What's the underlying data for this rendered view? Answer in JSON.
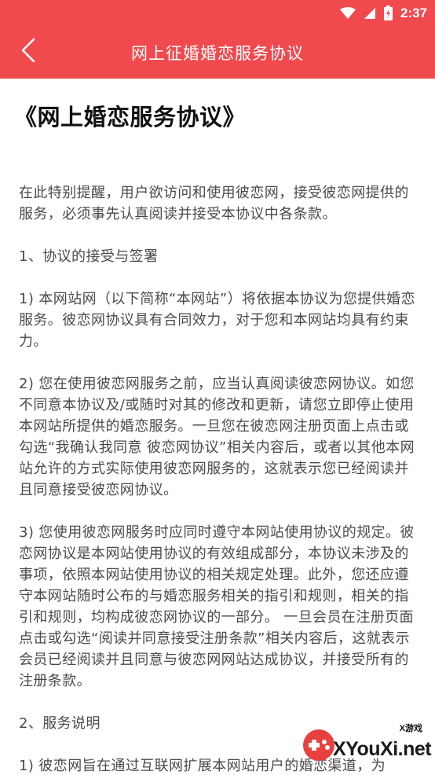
{
  "status_bar": {
    "time": "2:37",
    "icons": [
      "wifi-icon",
      "signal-icon",
      "battery-charging-icon"
    ]
  },
  "app_bar": {
    "title": "网上征婚婚恋服务协议",
    "back_icon": "chevron-left-icon"
  },
  "document": {
    "title": "《网上婚恋服务协议》",
    "paragraphs": [
      "在此特别提醒，用户欲访问和使用彼恋网，接受彼恋网提供的服务，必须事先认真阅读并接受本协议中各条款。",
      "1、协议的接受与签署",
      "1) 本网站网（以下简称“本网站”）将依据本协议为您提供婚恋服务。彼恋网协议具有合同效力，对于您和本网站均具有约束力。",
      "2) 您在使用彼恋网服务之前，应当认真阅读彼恋网协议。如您不同意本协议及/或随时对其的修改和更新，请您立即停止使用本网站所提供的婚恋服务。一旦您在彼恋网注册页面上点击或勾选“我确认我同意 彼恋网协议”相关内容后，或者以其他本网站允许的方式实际使用彼恋网服务的，这就表示您已经阅读并且同意接受彼恋网协议。",
      "3) 您使用彼恋网服务时应同时遵守本网站使用协议的规定。彼恋网协议是本网站使用协议的有效组成部分，本协议未涉及的事项，依照本网站使用协议的相关规定处理。此外，您还应遵守本网站随时公布的与婚恋服务相关的指引和规则，相关的指引和规则，均构成彼恋网协议的一部分。 一旦会员在注册页面点击或勾选“阅读并同意接受注册条款”相关内容后，这就表示会员已经阅读并且同意与彼恋网网站达成协议，并接受所有的注册条款。",
      "2、服务说明",
      "1) 彼恋网旨在通过互联网扩展本网站用户的婚恋渠道，为"
    ]
  },
  "watermark": {
    "text": "XYouXi.net",
    "small_text": "X游戏"
  },
  "colors": {
    "primary": "#f04a4f",
    "text": "#4a4a4a",
    "title": "#111111"
  }
}
